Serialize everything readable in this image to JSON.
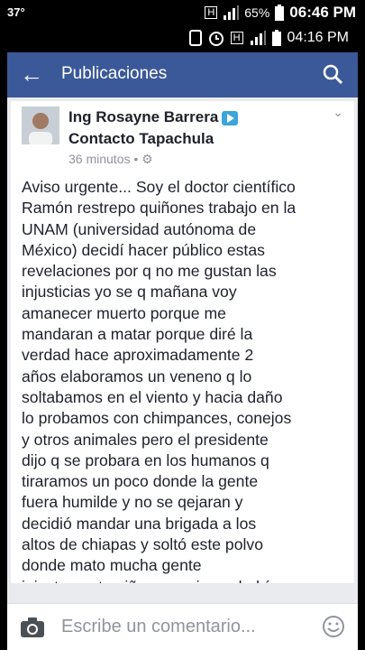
{
  "outer_status": {
    "temperature": "37°",
    "battery": "65%",
    "time": "06:46 PM",
    "network": "H"
  },
  "inner_status": {
    "time": "04:16 PM",
    "network": "H"
  },
  "appbar": {
    "title": "Publicaciones",
    "back_icon": "arrow-back-icon",
    "search_icon": "search-icon"
  },
  "post": {
    "author_line1": "Ing Rosayne Barrera",
    "author_line2": "Contacto Tapachula",
    "time_ago": "36 minutos",
    "privacy_icon": "gear-icon",
    "text": "Aviso urgente... Soy el doctor científico\nRamón restrepo quiñones trabajo en la\nUNAM (universidad autónoma de\nMéxico) decidí hacer público estas\nrevelaciones por q no me gustan las\ninjusticias yo se q mañana voy\namanecer muerto porque me\nmandaran a matar porque diré la\nverdad hace aproximadamente  2\naños elaboramos un veneno q lo\nsoltabamos en el viento y hacia daño\nlo probamos con chimpances, conejos\ny otros animales pero el presidente\ndijo q se probara en los humanos q\ntiraramos un poco donde la gente\nfuera humilde y no se qejaran y\ndecidió mandar una brigada a los\naltos de chiapas y soltó este polvo\ndonde mato mucha gente\ninjustamente niños y ancianos habían"
  },
  "comment": {
    "placeholder": "Escribe un comentario..."
  },
  "colors": {
    "appbar": "#3b5998",
    "background": "#e9ebee"
  }
}
